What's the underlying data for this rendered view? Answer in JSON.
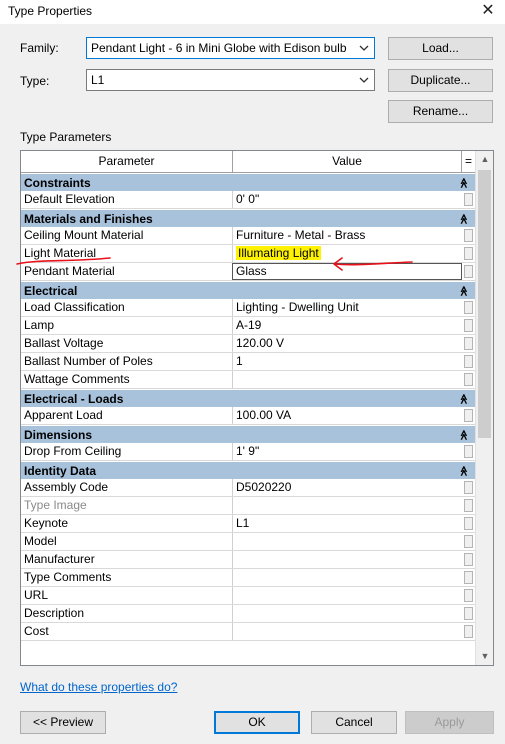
{
  "window": {
    "title": "Type Properties",
    "close_glyph": "✕"
  },
  "family": {
    "label": "Family:",
    "value": "Pendant Light - 6 in Mini Globe with Edison bulb"
  },
  "type": {
    "label": "Type:",
    "value": "L1"
  },
  "buttons": {
    "load": "Load...",
    "duplicate": "Duplicate...",
    "rename": "Rename..."
  },
  "type_parameters_label": "Type Parameters",
  "grid": {
    "headers": {
      "parameter": "Parameter",
      "value": "Value",
      "eq": "="
    },
    "groups": [
      {
        "name": "Constraints",
        "rows": [
          {
            "p": "Default Elevation",
            "v": "0'  0\""
          }
        ]
      },
      {
        "name": "Materials and Finishes",
        "rows": [
          {
            "p": "Ceiling Mount Material",
            "v": "Furniture - Metal - Brass"
          },
          {
            "p": "Light Material",
            "v": "Illumating Light"
          },
          {
            "p": "Pendant Material",
            "v": "Glass"
          }
        ]
      },
      {
        "name": "Electrical",
        "rows": [
          {
            "p": "Load Classification",
            "v": "Lighting - Dwelling Unit"
          },
          {
            "p": "Lamp",
            "v": "A-19"
          },
          {
            "p": "Ballast Voltage",
            "v": "120.00 V"
          },
          {
            "p": "Ballast Number of Poles",
            "v": "1"
          },
          {
            "p": "Wattage Comments",
            "v": ""
          }
        ]
      },
      {
        "name": "Electrical - Loads",
        "rows": [
          {
            "p": "Apparent Load",
            "v": "100.00 VA"
          }
        ]
      },
      {
        "name": "Dimensions",
        "rows": [
          {
            "p": "Drop From Ceiling",
            "v": "1'  9\""
          }
        ]
      },
      {
        "name": "Identity Data",
        "rows": [
          {
            "p": "Assembly Code",
            "v": "D5020220"
          },
          {
            "p": "Type Image",
            "v": ""
          },
          {
            "p": "Keynote",
            "v": "L1"
          },
          {
            "p": "Model",
            "v": ""
          },
          {
            "p": "Manufacturer",
            "v": ""
          },
          {
            "p": "Type Comments",
            "v": ""
          },
          {
            "p": "URL",
            "v": ""
          },
          {
            "p": "Description",
            "v": ""
          },
          {
            "p": "Cost",
            "v": ""
          }
        ]
      }
    ]
  },
  "help_link": "What do these properties do?",
  "footer": {
    "preview": "<< Preview",
    "ok": "OK",
    "cancel": "Cancel",
    "apply": "Apply"
  },
  "colors": {
    "group_header": "#a8c2dc",
    "highlight": "#fff200",
    "annotation": "#e8111b",
    "link": "#0066cc"
  }
}
